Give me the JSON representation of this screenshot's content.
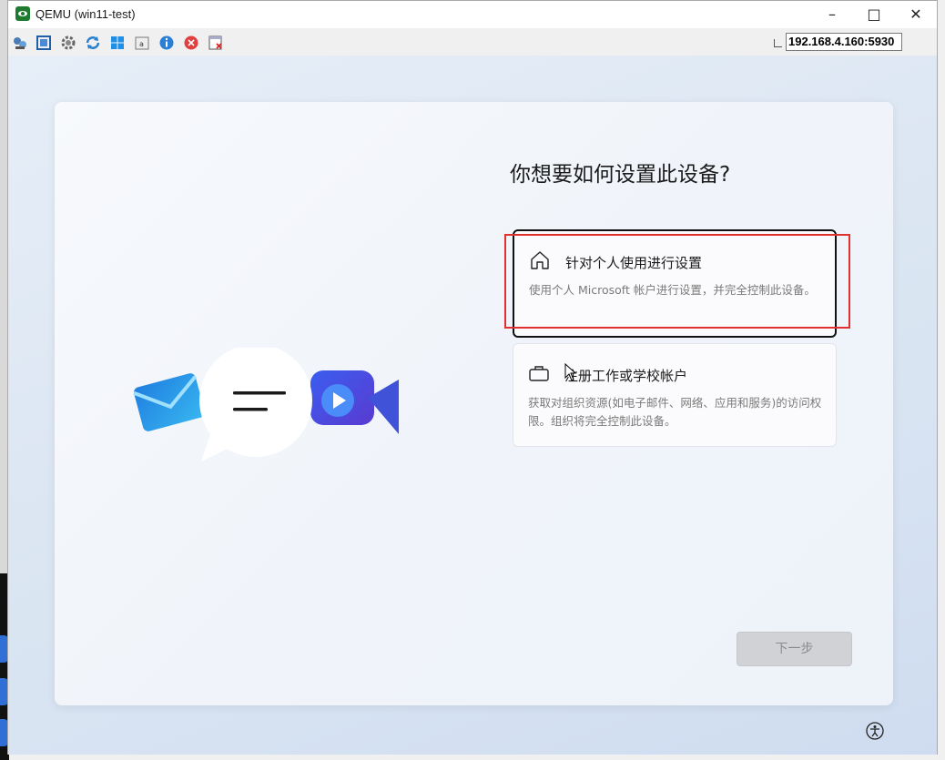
{
  "window": {
    "title": "QEMU (win11-test)",
    "address": "192.168.4.160:5930"
  },
  "toolbar": {
    "icons": [
      "network-icon",
      "fullscreen-icon",
      "settings-icon",
      "refresh-icon",
      "windows-icon",
      "keyboard-icon",
      "info-icon",
      "close-circle-icon",
      "disconnect-icon"
    ]
  },
  "setup": {
    "heading": "你想要如何设置此设备?",
    "options": [
      {
        "title": "针对个人使用进行设置",
        "description": "使用个人 Microsoft 帐户进行设置，并完全控制此设备。",
        "icon": "home-icon",
        "selected": true
      },
      {
        "title": "注册工作或学校帐户",
        "description": "获取对组织资源(如电子邮件、网络、应用和服务)的访问权限。组织将完全控制此设备。",
        "icon": "briefcase-icon",
        "selected": false
      }
    ],
    "next_label": "下一步"
  },
  "colors": {
    "highlight": "#e03030",
    "accent": "#1e7a2e"
  }
}
